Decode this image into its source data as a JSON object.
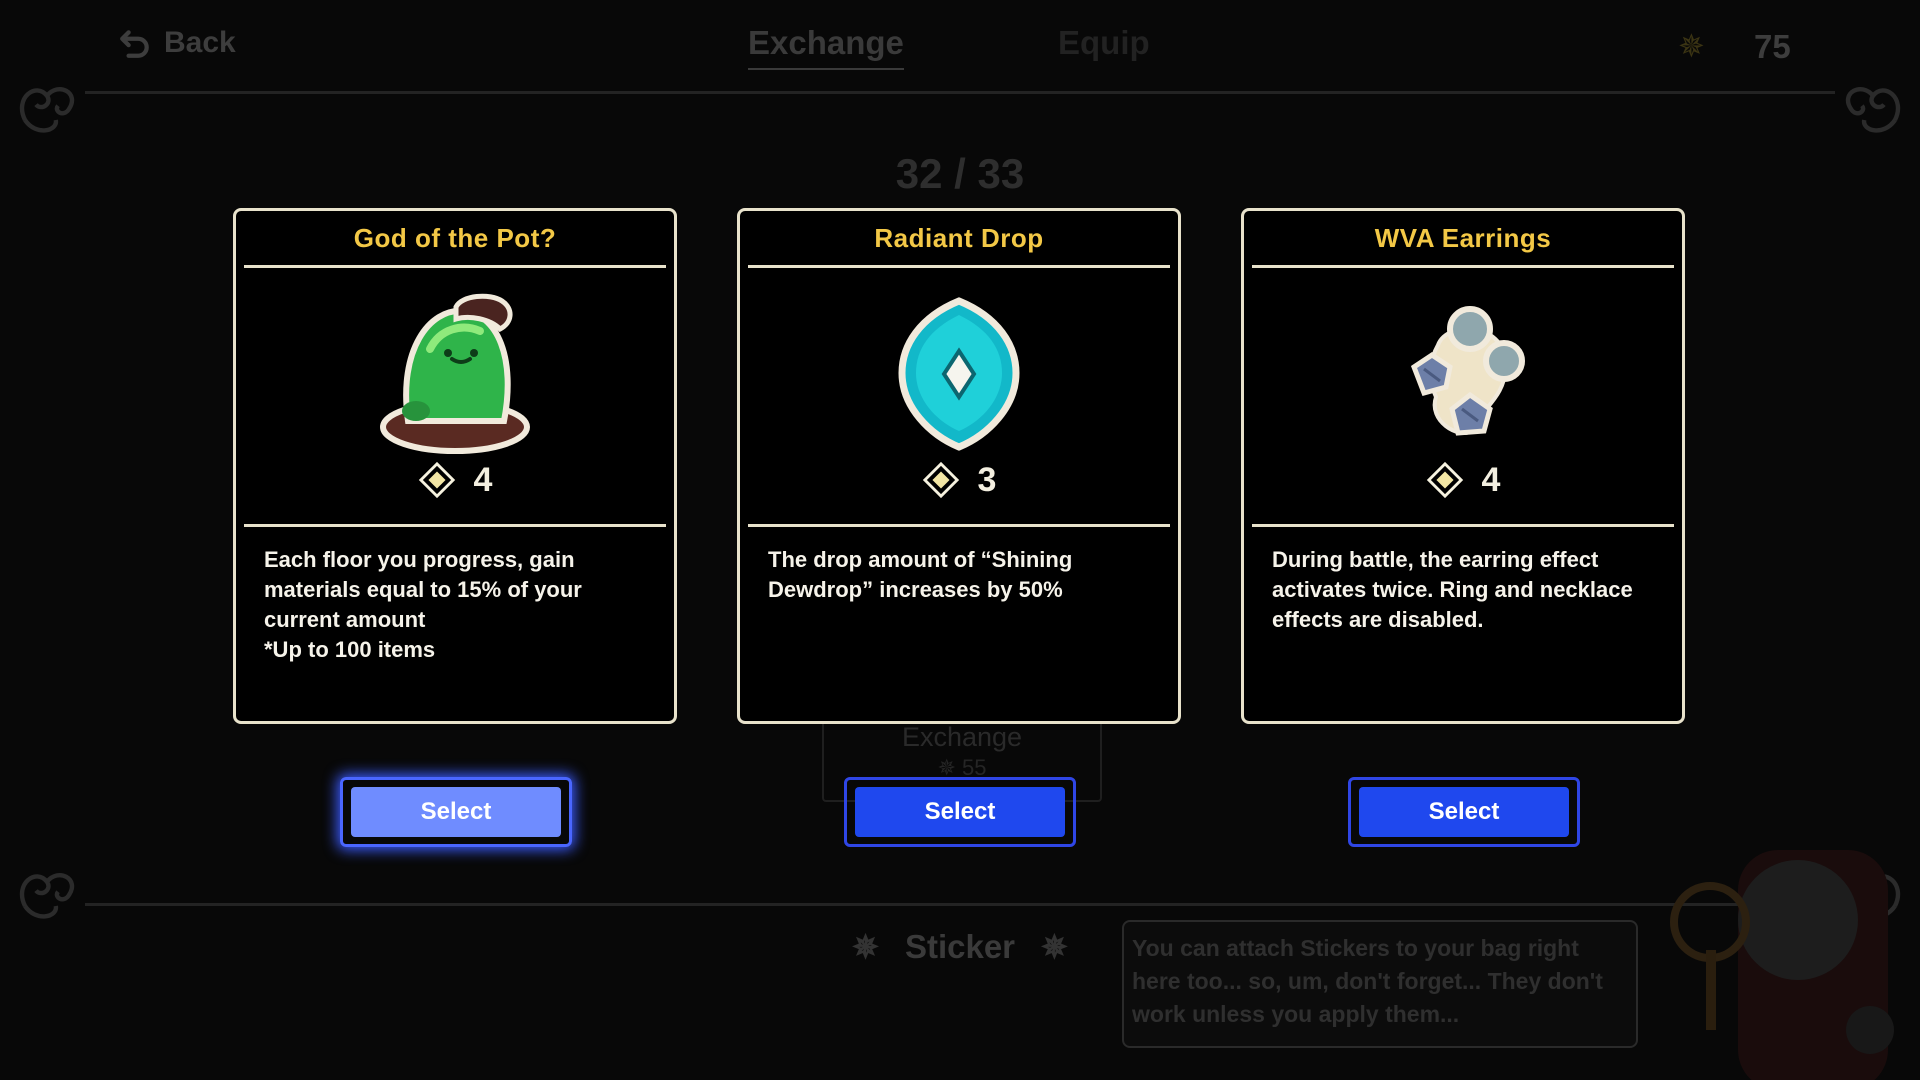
{
  "topbar": {
    "back_label": "Back",
    "tabs": [
      {
        "label": "Exchange",
        "active": true
      },
      {
        "label": "Equip",
        "active": false
      }
    ],
    "currency_icon": "gear-star-icon",
    "currency_count": "75"
  },
  "progress": {
    "counter": "32 / 33"
  },
  "cards": [
    {
      "title": "God of the Pot?",
      "icon": "green-pot-creature-icon",
      "cost": "4",
      "description": "Each floor you progress, gain materials equal to 15% of your current amount\n*Up to 100 items",
      "select_label": "Select",
      "highlighted": true
    },
    {
      "title": "Radiant Drop",
      "icon": "cyan-drop-gem-icon",
      "cost": "3",
      "description": "The drop amount of “Shining Dewdrop” increases by 50%",
      "select_label": "Select",
      "highlighted": false
    },
    {
      "title": "WVA Earrings",
      "icon": "pearl-earrings-icon",
      "cost": "4",
      "description": "During battle, the earring effect activates twice. Ring and necklace effects are disabled.",
      "select_label": "Select",
      "highlighted": false
    }
  ],
  "background": {
    "exchange_button": {
      "label": "Exchange",
      "cost": "55"
    },
    "sticker_label": "Sticker",
    "speech_text": "You can attach Stickers to your bag right here too... so, um, don't forget... They don't work unless you apply them..."
  },
  "colors": {
    "title_gold": "#f3c846",
    "card_border": "#e8e2cb",
    "button_blue": "#1f48ee",
    "button_highlight": "#6f8cff"
  }
}
